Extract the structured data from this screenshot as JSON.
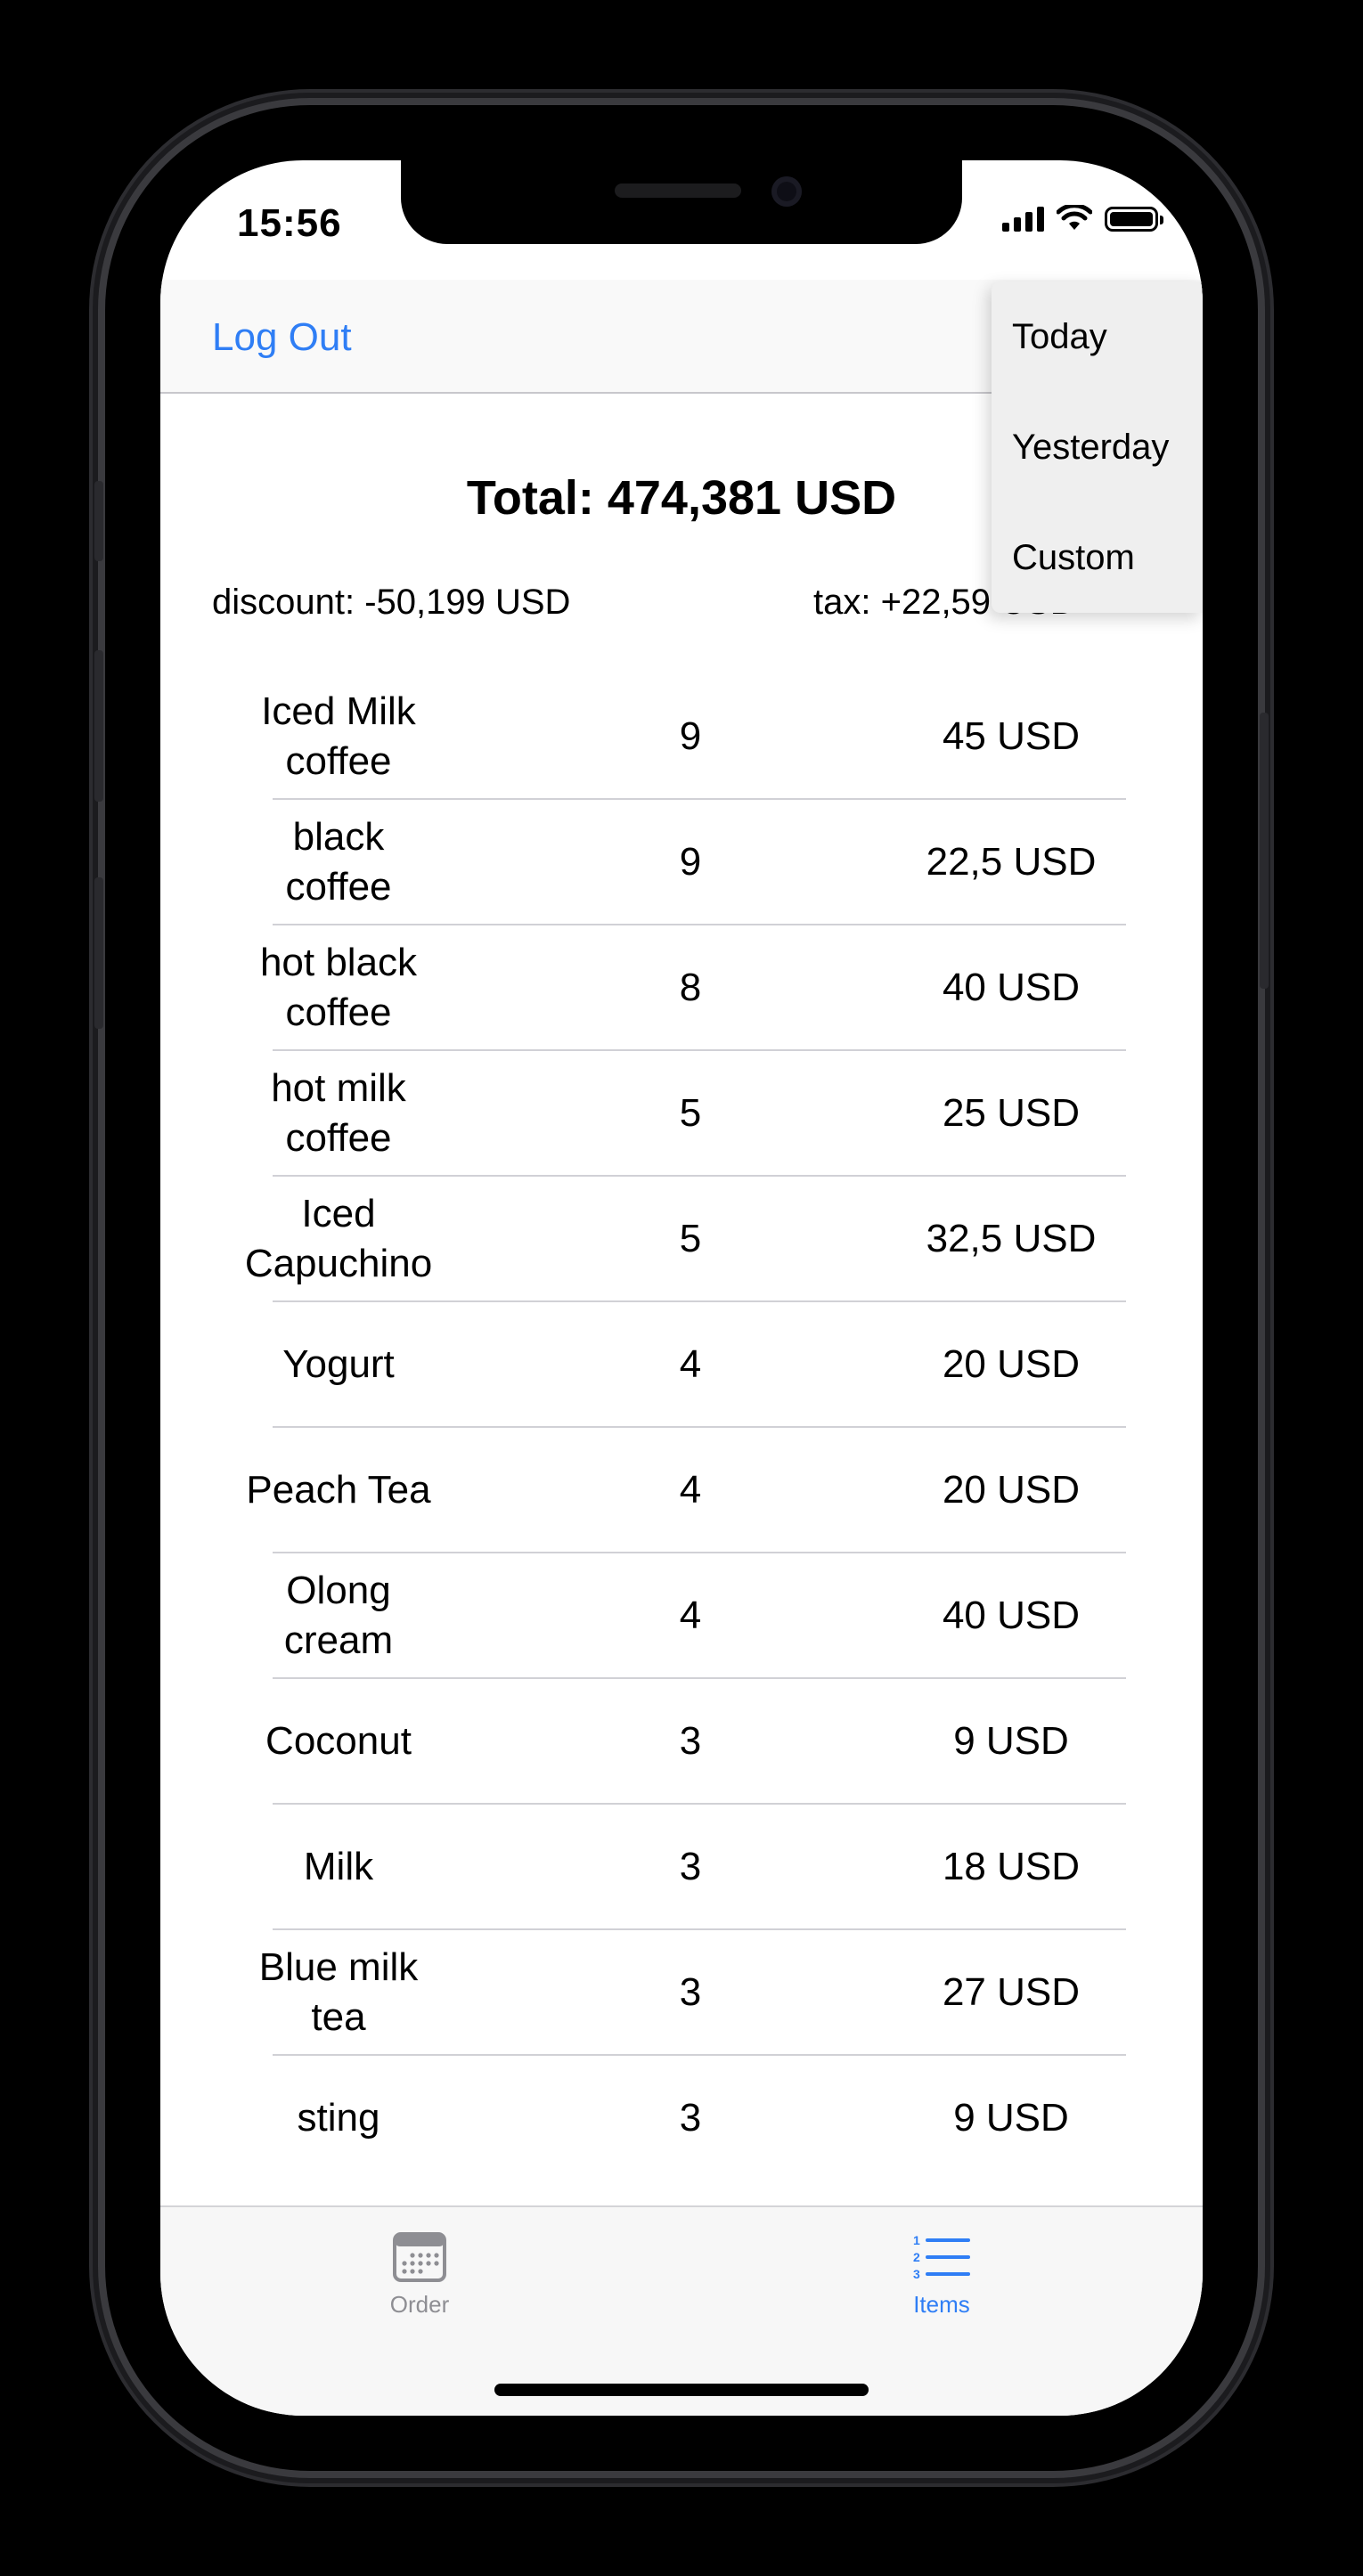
{
  "status_bar": {
    "time": "15:56"
  },
  "nav": {
    "logout_label": "Log Out"
  },
  "summary": {
    "total": "Total: 474,381 USD",
    "discount": "discount: -50,199 USD",
    "tax": "tax: +22,59 USD"
  },
  "date_menu": {
    "options": [
      "Today",
      "Yesterday",
      "Custom"
    ]
  },
  "items": [
    {
      "name": "Iced Milk coffee",
      "qty": "9",
      "price": "45 USD"
    },
    {
      "name": "black coffee",
      "qty": "9",
      "price": "22,5 USD"
    },
    {
      "name": "hot black coffee",
      "qty": "8",
      "price": "40 USD"
    },
    {
      "name": "hot milk coffee",
      "qty": "5",
      "price": "25 USD"
    },
    {
      "name": "Iced Capuchino",
      "qty": "5",
      "price": "32,5 USD"
    },
    {
      "name": "Yogurt",
      "qty": "4",
      "price": "20 USD"
    },
    {
      "name": "Peach Tea",
      "qty": "4",
      "price": "20 USD"
    },
    {
      "name": "Olong cream",
      "qty": "4",
      "price": "40 USD"
    },
    {
      "name": "Coconut",
      "qty": "3",
      "price": "9 USD"
    },
    {
      "name": "Milk",
      "qty": "3",
      "price": "18 USD"
    },
    {
      "name": "Blue milk tea",
      "qty": "3",
      "price": "27 USD"
    },
    {
      "name": "sting",
      "qty": "3",
      "price": "9 USD"
    }
  ],
  "tabbar": {
    "order_label": "Order",
    "items_label": "Items",
    "active_tab": "Items",
    "active_color": "#2f7ef5",
    "inactive_color": "#8e8e93"
  }
}
